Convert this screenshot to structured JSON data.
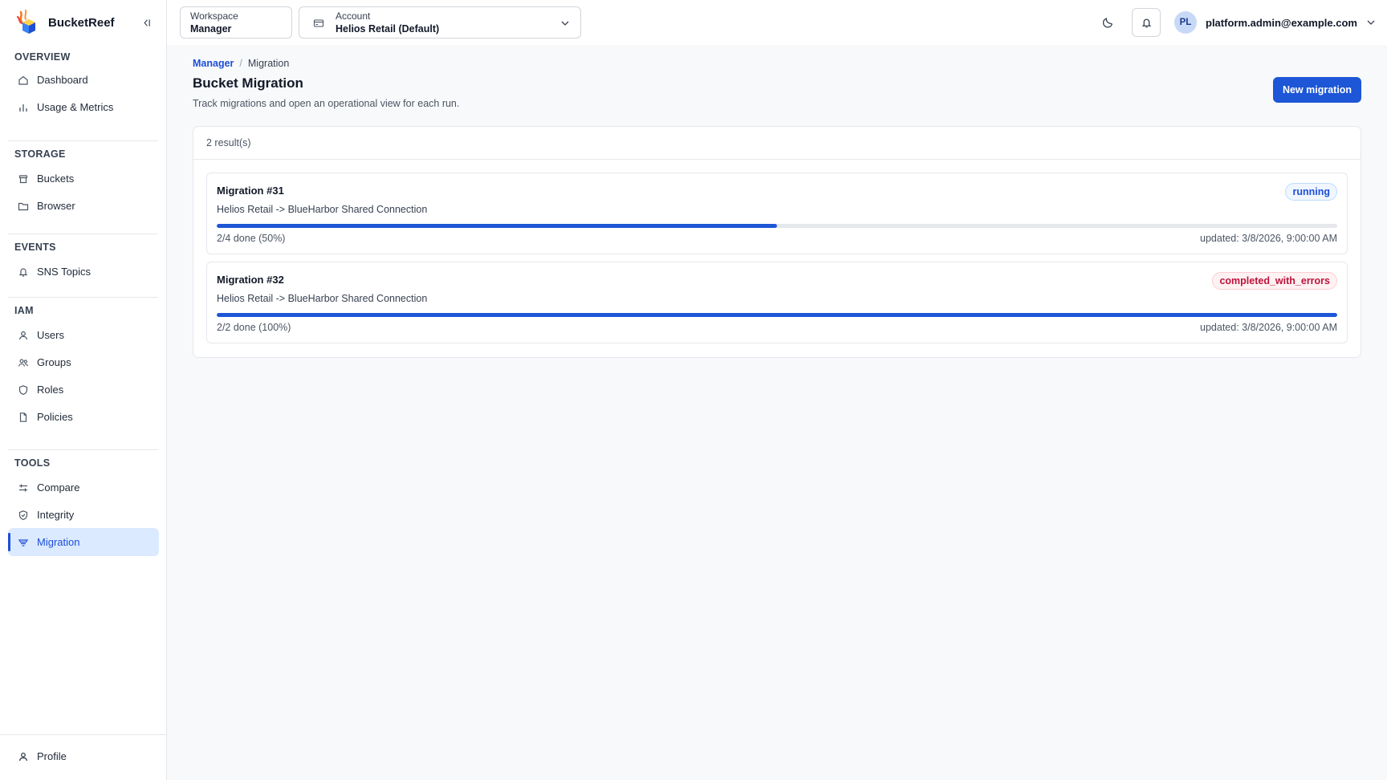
{
  "app": {
    "name": "BucketReef"
  },
  "sidebar": {
    "sections": [
      {
        "heading": "OVERVIEW",
        "items": [
          {
            "label": "Dashboard",
            "icon": "home-icon"
          },
          {
            "label": "Usage & Metrics",
            "icon": "bar-chart-icon"
          }
        ]
      },
      {
        "heading": "STORAGE",
        "items": [
          {
            "label": "Buckets",
            "icon": "bucket-icon"
          },
          {
            "label": "Browser",
            "icon": "folder-icon"
          }
        ]
      },
      {
        "heading": "EVENTS",
        "items": [
          {
            "label": "SNS Topics",
            "icon": "bell-icon"
          }
        ]
      },
      {
        "heading": "IAM",
        "items": [
          {
            "label": "Users",
            "icon": "user-icon"
          },
          {
            "label": "Groups",
            "icon": "users-icon"
          },
          {
            "label": "Roles",
            "icon": "shield-icon"
          },
          {
            "label": "Policies",
            "icon": "file-icon"
          }
        ]
      },
      {
        "heading": "TOOLS",
        "items": [
          {
            "label": "Compare",
            "icon": "compare-icon"
          },
          {
            "label": "Integrity",
            "icon": "shield-check-icon"
          },
          {
            "label": "Migration",
            "icon": "migration-icon",
            "active": true
          }
        ]
      }
    ],
    "footer": {
      "profile_label": "Profile"
    }
  },
  "topbar": {
    "workspace": {
      "label": "Workspace",
      "value": "Manager"
    },
    "account": {
      "label": "Account",
      "value": "Helios Retail (Default)"
    },
    "user": {
      "initials": "PL",
      "email": "platform.admin@example.com"
    }
  },
  "breadcrumb": {
    "parent": "Manager",
    "separator": "/",
    "current": "Migration"
  },
  "page": {
    "title": "Bucket Migration",
    "subtitle": "Track migrations and open an operational view for each run.",
    "new_button": "New migration"
  },
  "results": {
    "count_label": "2 result(s)",
    "migrations": [
      {
        "title": "Migration #31",
        "route": "Helios Retail -> BlueHarbor Shared Connection",
        "status": "running",
        "progress": 0.5,
        "done_label": "2/4 done (50%)",
        "updated_label": "updated: 3/8/2026, 9:00:00 AM"
      },
      {
        "title": "Migration #32",
        "route": "Helios Retail -> BlueHarbor Shared Connection",
        "status": "completed_with_errors",
        "progress": 1.0,
        "done_label": "2/2 done (100%)",
        "updated_label": "updated: 3/8/2026, 9:00:00 AM"
      }
    ]
  },
  "colors": {
    "accent": "#1d56d6",
    "active_bg": "#dbeafe",
    "running": "#1d4ed8",
    "error": "#be123c"
  }
}
